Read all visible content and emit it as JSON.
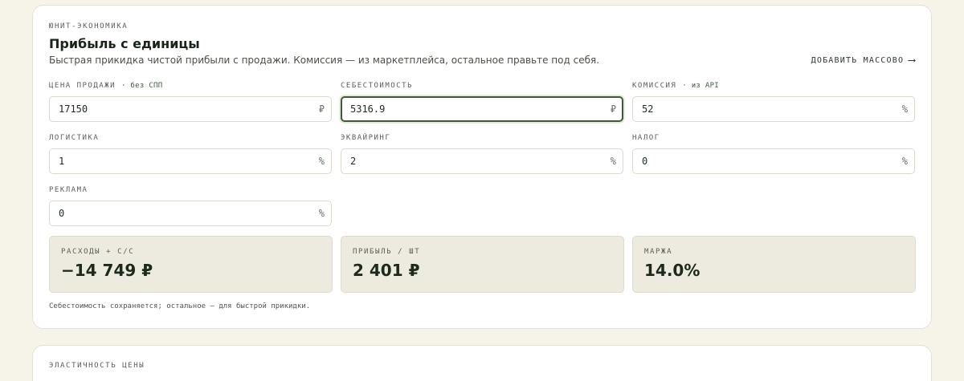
{
  "unit": {
    "kicker": "ЮНИТ-ЭКОНОМИКА",
    "title": "Прибыль с единицы",
    "subtitle": "Быстрая прикидка чистой прибыли с продажи. Комиссия — из маркетплейса, остальное правьте под себя.",
    "bulk_button": "ДОБАВИТЬ МАССОВО",
    "bulk_arrow": "⟶",
    "fields": {
      "price": {
        "label": "ЦЕНА ПРОДАЖИ",
        "sub": "· без СПП",
        "value": "17150",
        "unit": "₽"
      },
      "cost": {
        "label": "СЕБЕСТОИМОСТЬ",
        "value": "5316.9",
        "unit": "₽"
      },
      "commission": {
        "label": "КОМИССИЯ",
        "sub": "· из API",
        "value": "52",
        "unit": "%"
      },
      "logistics": {
        "label": "ЛОГИСТИКА",
        "value": "1",
        "unit": "%"
      },
      "acquiring": {
        "label": "ЭКВАЙРИНГ",
        "value": "2",
        "unit": "%"
      },
      "tax": {
        "label": "НАЛОГ",
        "value": "0",
        "unit": "%"
      },
      "ads": {
        "label": "РЕКЛАМА",
        "value": "0",
        "unit": "%"
      }
    },
    "metrics": {
      "expenses": {
        "label": "РАСХОДЫ + С/С",
        "value": "−14 749 ₽"
      },
      "profit": {
        "label": "ПРИБЫЛЬ / ШТ",
        "value": "2 401 ₽"
      },
      "margin": {
        "label": "МАРЖА",
        "value": "14.0%"
      }
    },
    "note": "Себестоимость сохраняется; остальное — для быстрой прикидки."
  },
  "elasticity": {
    "kicker": "ЭЛАСТИЧНОСТЬ ЦЕНЫ"
  },
  "colors": {
    "background": "#f6f4e9",
    "accent": "#3e5a38",
    "metric_bg": "#edebe0"
  }
}
